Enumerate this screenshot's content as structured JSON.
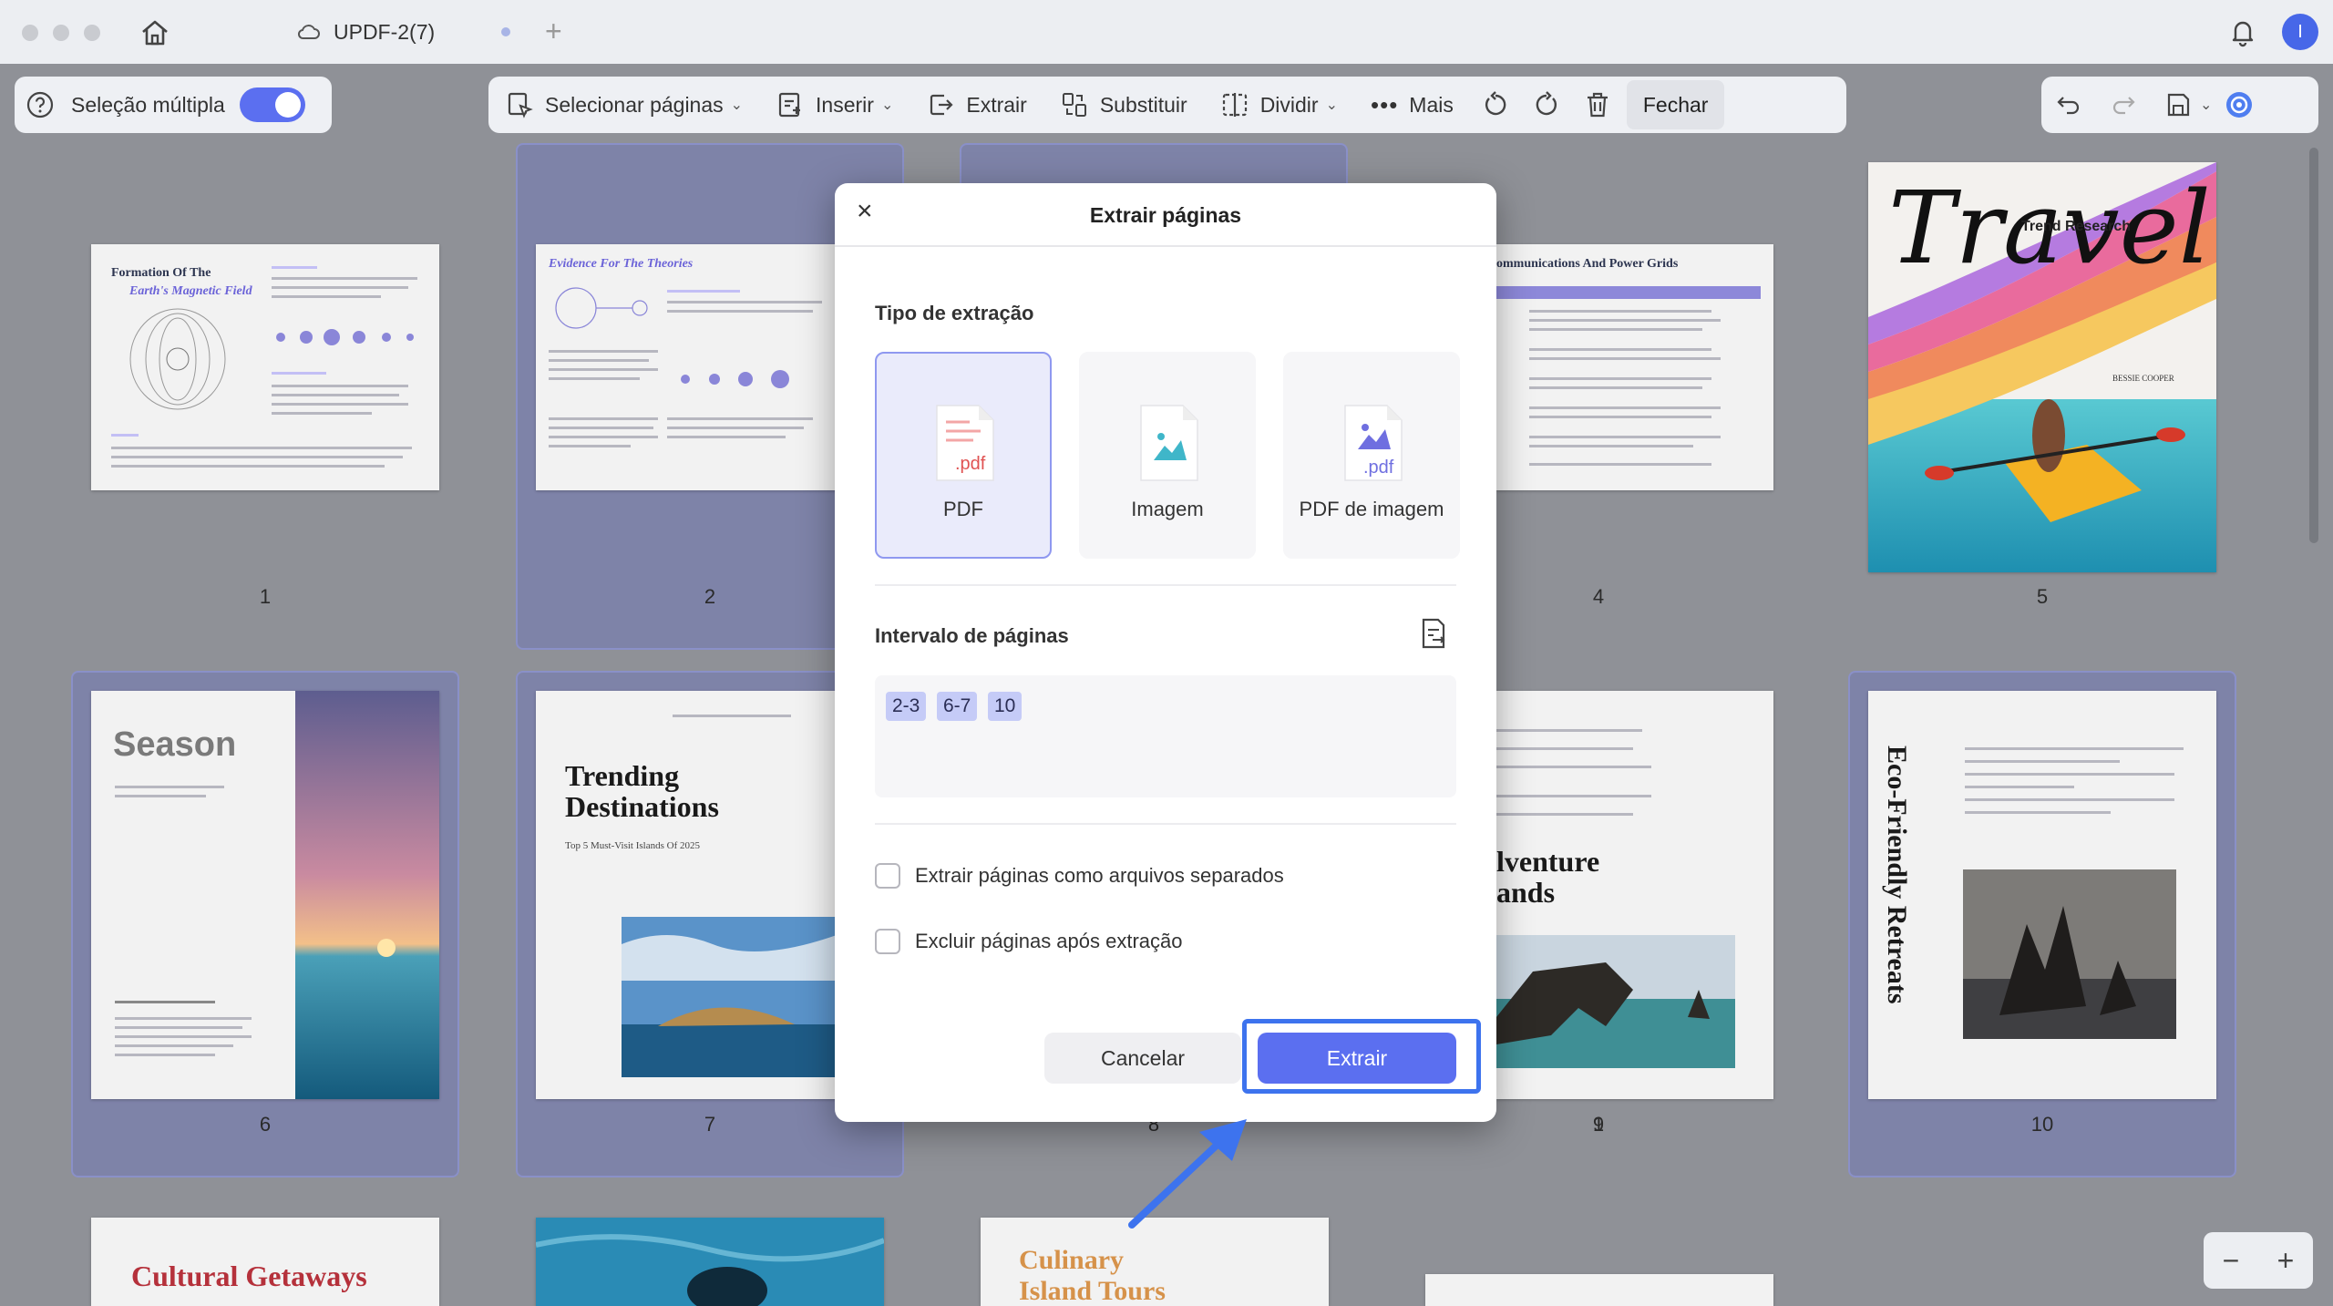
{
  "titlebar": {
    "tab_title": "UPDF-2(7)",
    "avatar_letter": "I"
  },
  "toolbar": {
    "multi_select_label": "Seleção múltipla",
    "multi_select_on": true,
    "select_pages": "Selecionar páginas",
    "insert": "Inserir",
    "extract": "Extrair",
    "replace": "Substituir",
    "split": "Dividir",
    "more": "Mais",
    "close": "Fechar"
  },
  "pages": [
    {
      "number": "1",
      "title_line1": "Formation Of The",
      "title_line2": "Earth's Magnetic Field"
    },
    {
      "number": "2",
      "title_line1": "Evidence For The Theories"
    },
    {
      "number": "4",
      "title_line1": "ommunications And Power Grids"
    },
    {
      "number": "5",
      "title_line1": "Travel",
      "subtitle": "Trend Research",
      "author": "BESSIE COOPER"
    },
    {
      "number": "6",
      "title_line1": "Season"
    },
    {
      "number": "7",
      "title_line1": "Trending",
      "title_line2": "Destinations",
      "subtitle": "Top 5 Must-Visit Islands Of 2025"
    },
    {
      "number": "8"
    },
    {
      "number": "9",
      "title_line1": "lventure",
      "title_line2": "ands"
    },
    {
      "number": "10",
      "title_line1": "Eco-Friendly Retreats"
    },
    {
      "title_line1": "Cultural Getaways"
    },
    {
      "title_line1": "Culinary",
      "title_line2": "Island Tours"
    }
  ],
  "dialog": {
    "title": "Extrair páginas",
    "type_label": "Tipo de extração",
    "types": [
      {
        "label": "PDF",
        "icon_ext": ".pdf",
        "selected": true
      },
      {
        "label": "Imagem",
        "selected": false
      },
      {
        "label": "PDF de imagem",
        "icon_ext": ".pdf",
        "selected": false
      }
    ],
    "range_label": "Intervalo de páginas",
    "ranges": [
      "2-3",
      "6-7",
      "10"
    ],
    "option_separate": "Extrair páginas como arquivos separados",
    "option_delete": "Excluir páginas após extração",
    "cancel": "Cancelar",
    "extract": "Extrair"
  },
  "colors": {
    "accent": "#5b6ff0",
    "selection_border": "#8f98f0",
    "highlight_ring": "#3d73ee"
  }
}
